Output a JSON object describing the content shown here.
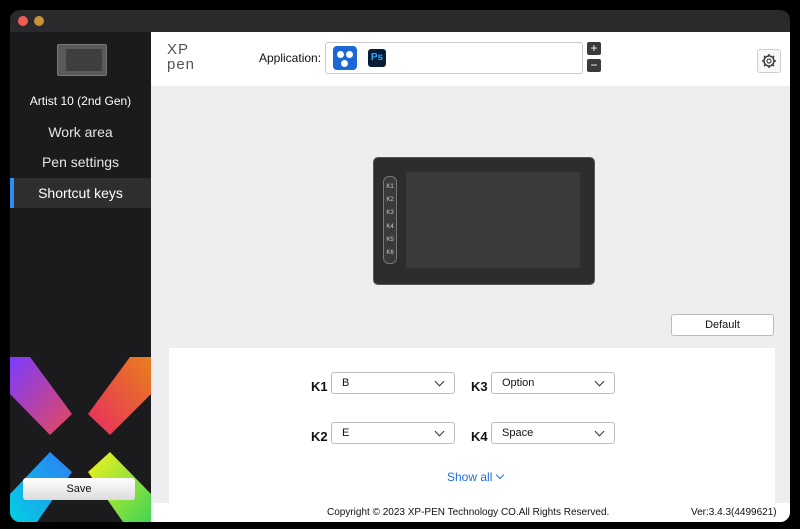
{
  "sidebar": {
    "device_name": "Artist 10 (2nd Gen)",
    "items": [
      {
        "label": "Work area",
        "active": false
      },
      {
        "label": "Pen settings",
        "active": false
      },
      {
        "label": "Shortcut keys",
        "active": true
      }
    ],
    "save_label": "Save"
  },
  "header": {
    "logo_top": "XP",
    "logo_bottom": "pen",
    "application_label": "Application:",
    "app_icons": [
      "all-apps-icon",
      "photoshop-icon"
    ],
    "photoshop_text": "Ps",
    "add_label": "+",
    "remove_label": "−",
    "settings_icon": "gear-icon"
  },
  "tablet": {
    "keys": [
      "K1",
      "K2",
      "K3",
      "K4",
      "K5",
      "K6"
    ]
  },
  "default_label": "Default",
  "shortcut_keys": [
    {
      "key": "K1",
      "value": "B"
    },
    {
      "key": "K2",
      "value": "E"
    },
    {
      "key": "K3",
      "value": "Option"
    },
    {
      "key": "K4",
      "value": "Space"
    }
  ],
  "show_all_label": "Show all",
  "footer": {
    "copyright": "Copyright © 2023  XP-PEN Technology CO.All Rights Reserved.",
    "version": "Ver:3.4.3(4499621)"
  },
  "colors": {
    "accent": "#2f8ef0",
    "link": "#1d6fd6",
    "sidebar_bg": "#1b1b1d"
  }
}
